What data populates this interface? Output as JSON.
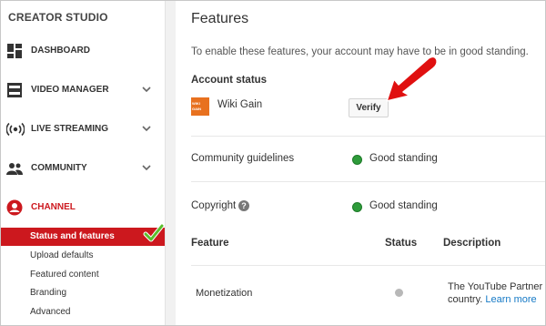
{
  "sidebar": {
    "title": "CREATOR STUDIO",
    "items": [
      {
        "label": "DASHBOARD",
        "icon": "dashboard-icon"
      },
      {
        "label": "VIDEO MANAGER",
        "icon": "video-manager-icon"
      },
      {
        "label": "LIVE STREAMING",
        "icon": "live-streaming-icon"
      },
      {
        "label": "COMMUNITY",
        "icon": "community-icon"
      },
      {
        "label": "CHANNEL",
        "icon": "channel-icon"
      }
    ],
    "sub_items": [
      {
        "label": "Status and features"
      },
      {
        "label": "Upload defaults"
      },
      {
        "label": "Featured content"
      },
      {
        "label": "Branding"
      },
      {
        "label": "Advanced"
      }
    ],
    "accent_color": "#cc181e"
  },
  "main": {
    "title": "Features",
    "intro": "To enable these features, your account may have to be in good standing.",
    "account_status": {
      "heading": "Account status",
      "channel_name": "Wiki Gain",
      "channel_thumb_text": [
        "WIKI",
        "GAIN"
      ],
      "verify_label": "Verify"
    },
    "rows": [
      {
        "label": "Community guidelines",
        "status": "Good standing"
      },
      {
        "label": "Copyright",
        "help": "?",
        "status": "Good standing"
      }
    ],
    "table": {
      "headers": [
        "Feature",
        "Status",
        "Description"
      ],
      "rows": [
        {
          "feature": "Monetization",
          "description": "The YouTube Partner",
          "description_2": "country.",
          "link": "Learn more"
        }
      ]
    },
    "status_color": "#2e9b3a"
  }
}
